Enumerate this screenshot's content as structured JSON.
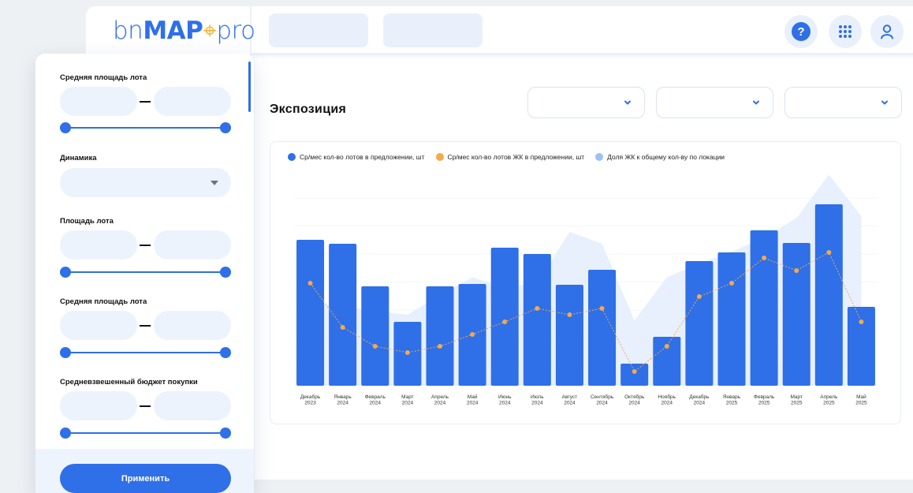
{
  "app": {
    "logo_prefix": "bn",
    "logo_main": "MAP",
    "logo_suffix": "pro"
  },
  "topbar": {
    "help_label": "?"
  },
  "filters": {
    "avg_lot_area_label": "Средняя площадь лота",
    "dynamics_label": "Динамика",
    "lot_area_label": "Площадь лота",
    "avg_lot_area_label_2": "Средняя площадь лота",
    "weighted_budget_label": "Средневзвешенный бюджет покупки",
    "apply_label": "Применить"
  },
  "main": {
    "title": "Экспозиция"
  },
  "colors": {
    "accent": "#2f6fe8",
    "orange": "#f6a84b",
    "area": "#e3edfb",
    "light_blue": "#9cc2f4"
  },
  "chart_data": {
    "type": "bar",
    "categories": [
      [
        "Декабрь",
        "2023"
      ],
      [
        "Январь",
        "2024"
      ],
      [
        "Февраль",
        "2024"
      ],
      [
        "Март",
        "2024"
      ],
      [
        "Апрель",
        "2024"
      ],
      [
        "Май",
        "2024"
      ],
      [
        "Июнь",
        "2024"
      ],
      [
        "Июль",
        "2024"
      ],
      [
        "Август",
        "2024"
      ],
      [
        "Сентябрь",
        "2024"
      ],
      [
        "Октябрь",
        "2024"
      ],
      [
        "Ноябрь",
        "2024"
      ],
      [
        "Декабрь",
        "2024"
      ],
      [
        "Январь",
        "2025"
      ],
      [
        "Февраль",
        "2025"
      ],
      [
        "Март",
        "2025"
      ],
      [
        "Апрель",
        "2025"
      ],
      [
        "Май",
        "2025"
      ]
    ],
    "legend": [
      {
        "name": "Ср/мес кол-во лотов в предложении, шт",
        "color": "#2f6fe8"
      },
      {
        "name": "Ср/мес кол-во лотов ЖК в предложении, шт",
        "color": "#f6a84b"
      },
      {
        "name": "Доля ЖК к общему кол-ву по локации",
        "color": "#9cc2f4"
      }
    ],
    "series": [
      {
        "name": "Ср/мес кол-во лотов в предложении, шт",
        "kind": "bar",
        "values": [
          74,
          72,
          50.4,
          32.4,
          50.4,
          51.6,
          70,
          66.8,
          51.2,
          58.8,
          11.2,
          24.8,
          63.2,
          67.6,
          78.8,
          72.4,
          92,
          40
        ]
      },
      {
        "name": "Ср/мес кол-во лотов ЖК в предложении, шт",
        "kind": "line",
        "values": [
          52,
          29.6,
          20,
          16.8,
          20,
          26,
          32.4,
          39.2,
          36,
          39.2,
          7.2,
          20,
          45.2,
          52,
          64.8,
          58.4,
          67.6,
          32.4
        ]
      },
      {
        "name": "Доля ЖК к общему кол-ву по локации",
        "kind": "area",
        "values": [
          42,
          40,
          38,
          36,
          46,
          55,
          50,
          52,
          78,
          72,
          33,
          55,
          62,
          68,
          75,
          85,
          107,
          86
        ]
      }
    ],
    "ylim": [
      0,
      100
    ],
    "grid": true,
    "legend_position": "top-left"
  }
}
